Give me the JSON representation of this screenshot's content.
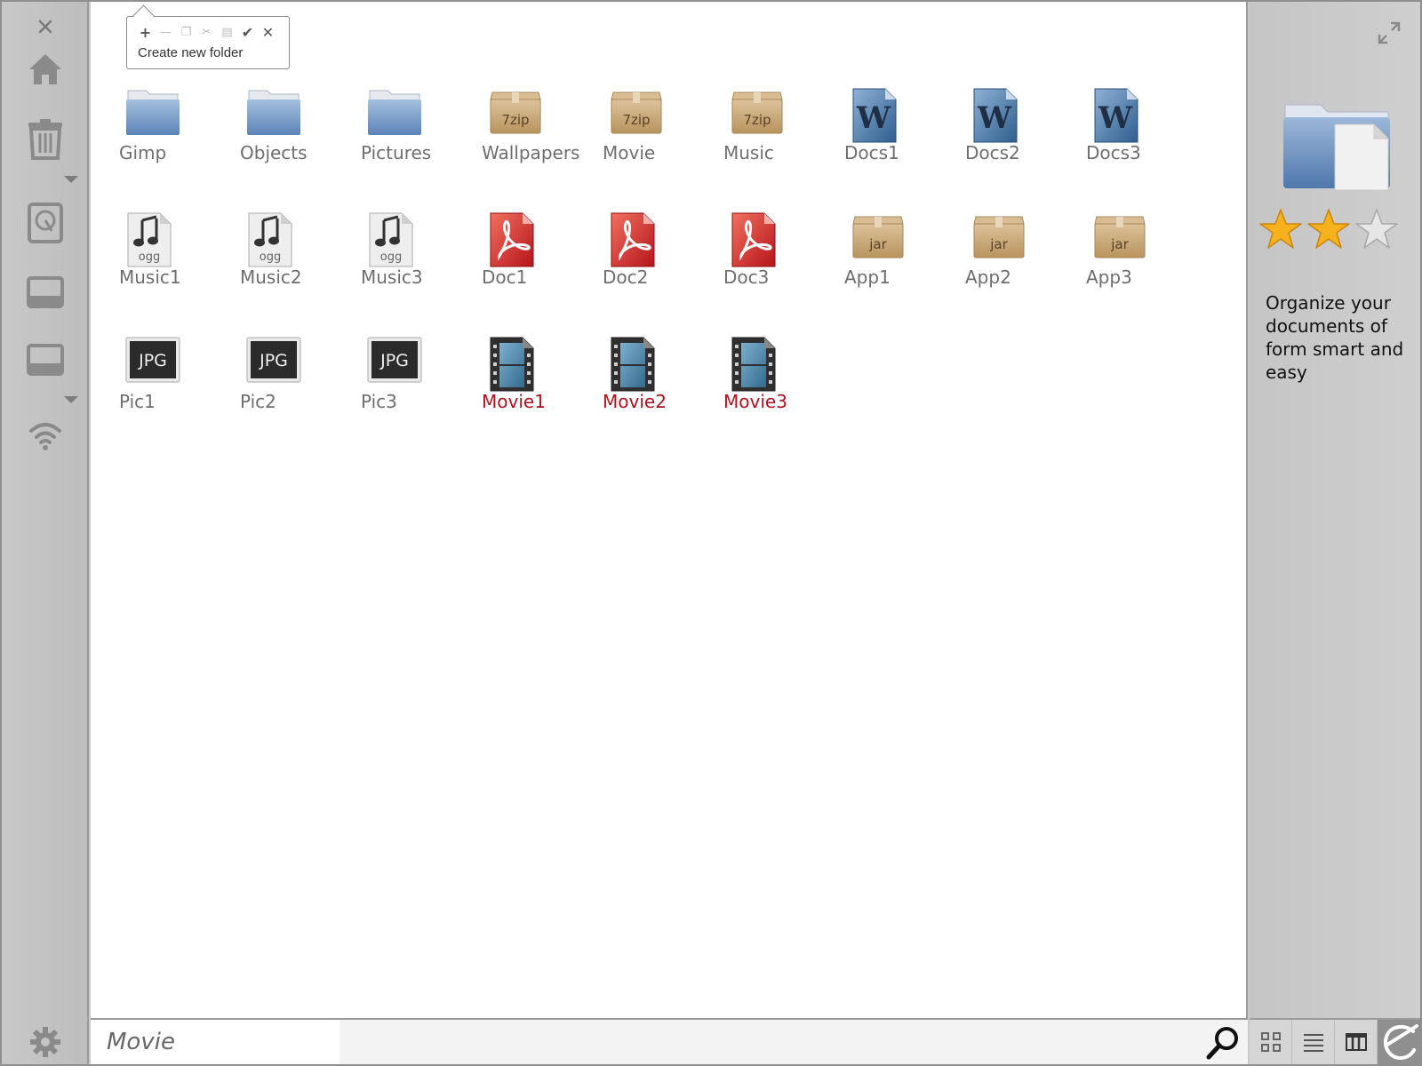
{
  "toolbar_popup": {
    "tooltip": "Create new folder",
    "tools": [
      "add-icon",
      "remove-icon",
      "copy-icon",
      "cut-icon",
      "paste-icon",
      "check-icon",
      "close-icon"
    ]
  },
  "files": [
    {
      "label": "Gimp",
      "type": "folder"
    },
    {
      "label": "Objects",
      "type": "folder"
    },
    {
      "label": "Pictures",
      "type": "folder"
    },
    {
      "label": "Wallpapers",
      "type": "archive",
      "badge": "7zip"
    },
    {
      "label": "Movie",
      "type": "archive",
      "badge": "7zip"
    },
    {
      "label": "Music",
      "type": "archive",
      "badge": "7zip"
    },
    {
      "label": "Docs1",
      "type": "word",
      "badge": "W"
    },
    {
      "label": "Docs2",
      "type": "word",
      "badge": "W"
    },
    {
      "label": "Docs3",
      "type": "word",
      "badge": "W"
    },
    {
      "label": "Music1",
      "type": "audio",
      "badge": "ogg"
    },
    {
      "label": "Music2",
      "type": "audio",
      "badge": "ogg"
    },
    {
      "label": "Music3",
      "type": "audio",
      "badge": "ogg"
    },
    {
      "label": "Doc1",
      "type": "pdf"
    },
    {
      "label": "Doc2",
      "type": "pdf"
    },
    {
      "label": "Doc3",
      "type": "pdf"
    },
    {
      "label": "App1",
      "type": "archive",
      "badge": "jar"
    },
    {
      "label": "App2",
      "type": "archive",
      "badge": "jar"
    },
    {
      "label": "App3",
      "type": "archive",
      "badge": "jar"
    },
    {
      "label": "Pic1",
      "type": "image",
      "badge": "JPG"
    },
    {
      "label": "Pic2",
      "type": "image",
      "badge": "JPG"
    },
    {
      "label": "Pic3",
      "type": "image",
      "badge": "JPG"
    },
    {
      "label": "Movie1",
      "type": "video",
      "highlight": true
    },
    {
      "label": "Movie2",
      "type": "video",
      "highlight": true
    },
    {
      "label": "Movie3",
      "type": "video",
      "highlight": true
    }
  ],
  "right_panel": {
    "rating": 2,
    "rating_max": 3,
    "description": "Organize your documents of form smart and easy"
  },
  "search": {
    "value": "Movie"
  },
  "colors": {
    "highlight": "#b0101e",
    "label": "#6e6e6e",
    "star": "#f6b21d"
  }
}
